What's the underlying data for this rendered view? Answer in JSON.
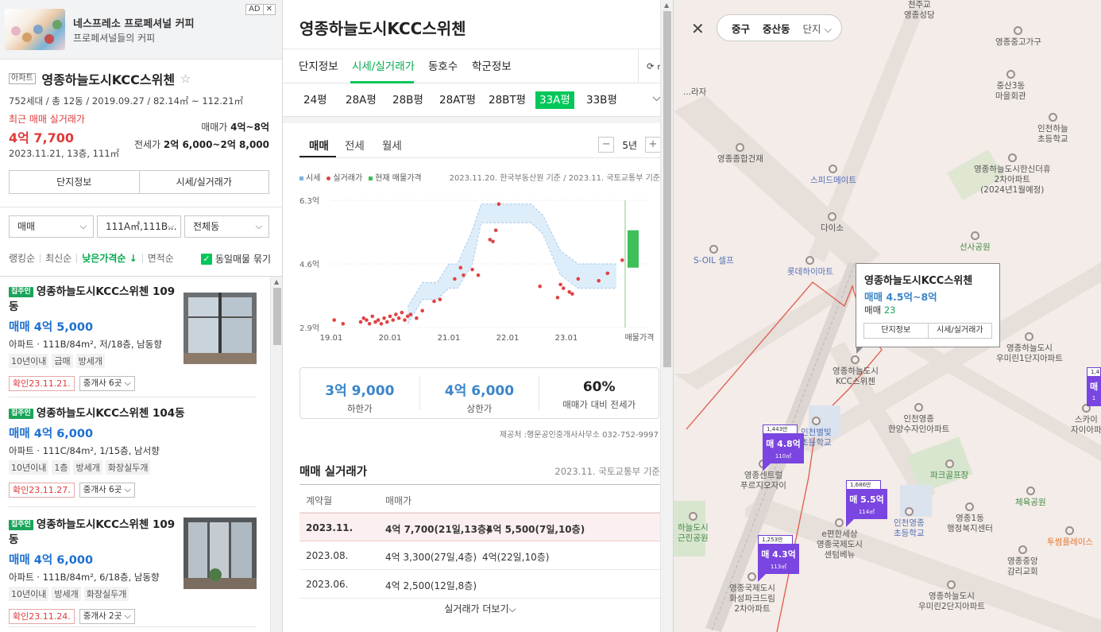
{
  "ad": {
    "title": "네스프레소 프로페셔널 커피",
    "subtitle": "프로페셔널들의 커피",
    "badge": "AD",
    "close": "✕"
  },
  "complex": {
    "type_tag": "아파트",
    "name": "영종하늘도시KCC스위첸",
    "star": "☆",
    "spec": "752세대 / 총 12동 / 2019.09.27 / 82.14㎡ ~ 112.21㎡",
    "recent_label": "최근 매매 실거래가",
    "recent_price": "4억 7,700",
    "recent_date": "2023.11.21, 13층, 111㎡",
    "sale_range_label": "매매가 ",
    "sale_range": "4억~8억",
    "jeonse_range_label": "전세가 ",
    "jeonse_range": "2억 6,000~2억 8,000",
    "btn_info": "단지정보",
    "btn_price": "시세/실거래가"
  },
  "filters": {
    "trade": "매매",
    "area": "111A㎡,111B...",
    "dong": "전체동",
    "sorts": [
      "랭킹순",
      "최신순",
      "낮은가격순 ↓",
      "면적순"
    ],
    "active_sort": 2,
    "group_label": "동일매물 묶기"
  },
  "listings": [
    {
      "badge": "집주인",
      "title": "영종하늘도시KCC스위첸 109동",
      "price": "매매 4억 5,000",
      "spec": "아파트 · 111B/84m², 저/18층, 남동향",
      "tags": [
        "10년이내",
        "급매",
        "방세개"
      ],
      "confirm": "확인23.11.21.",
      "agents": "중개사 6곳 ⌵",
      "has_photo": true
    },
    {
      "badge": "집주인",
      "title": "영종하늘도시KCC스위첸 104동",
      "price": "매매 4억 6,000",
      "spec": "아파트 · 111C/84m², 1/15층, 남서향",
      "tags": [
        "10년이내",
        "1층",
        "방세개",
        "화장실두개"
      ],
      "confirm": "확인23.11.27.",
      "agents": "중개사 6곳 ⌵",
      "has_photo": false
    },
    {
      "badge": "집주인",
      "title": "영종하늘도시KCC스위첸 109동",
      "price": "매매 4억 6,000",
      "spec": "아파트 · 111B/84m², 6/18층, 남동향",
      "tags": [
        "10년이내",
        "방세개",
        "화장실두개"
      ],
      "confirm": "확인23.11.24.",
      "agents": "중개사 2곳 ⌵",
      "has_photo": true
    }
  ],
  "center": {
    "title": "영종하늘도시KCC스위첸",
    "tabs": [
      "단지정보",
      "시세/실거래가",
      "동호수",
      "학군정보"
    ],
    "active_tab": 1,
    "refresh_label": "⟳ ㎡",
    "sizes": [
      "24평",
      "28A평",
      "28B평",
      "28AT평",
      "28BT평",
      "33A평",
      "33B평"
    ],
    "active_size": 5,
    "sub_tabs": [
      "매매",
      "전세",
      "월세"
    ],
    "period": "5년",
    "period_minus": "−",
    "period_plus": "+",
    "legend": [
      "시세",
      "실거래가",
      "현재 매물가격"
    ],
    "legend_src": "2023.11.20. 한국부동산원 기준 / 2023.11. 국토교통부 기준",
    "stats": [
      {
        "value": "3억 9,000",
        "label": "하한가"
      },
      {
        "value": "4억 6,000",
        "label": "상한가"
      },
      {
        "value": "60%",
        "label": "매매가 대비 전세가"
      }
    ],
    "provider": "제공처 :행운공인중개사사무소 032-752-9997",
    "deal_head": "매매 실거래가",
    "deal_src": "2023.11. 국토교통부 기준",
    "deal_cols": [
      "계약월",
      "매매가"
    ],
    "deals": [
      {
        "month": "2023.11.",
        "a": "4억 7,700(21일,13층)",
        "b": "4억 5,500(7일,10층)"
      },
      {
        "month": "2023.08.",
        "a": "4억 3,300(27일,4층)",
        "b": "4억(22일,10층)"
      },
      {
        "month": "2023.06.",
        "a": "4억 2,500(12일,8층)",
        "b": ""
      }
    ],
    "more": "실거래가 더보기⌵"
  },
  "chart_data": {
    "type": "line",
    "y_tick_labels": [
      "6.3억",
      "4.6억",
      "2.9억"
    ],
    "y_ticks": [
      6.3,
      4.6,
      2.9
    ],
    "x_tick_labels": [
      "19.01",
      "20.01",
      "21.01",
      "22.01",
      "23.01",
      "매물가격"
    ],
    "ylim": [
      2.9,
      6.3
    ],
    "grid": true,
    "series": [
      {
        "name": "시세",
        "x": [
          2019.0,
          2019.9,
          2020.3,
          2020.55,
          2020.8,
          2021.0,
          2021.15,
          2021.4,
          2021.55,
          2021.7,
          2022.0,
          2022.4,
          2022.6,
          2022.9,
          2023.2,
          2023.4,
          2023.85
        ],
        "upper": [
          null,
          null,
          3.45,
          4.1,
          4.1,
          4.6,
          4.6,
          5.5,
          6.2,
          6.2,
          6.2,
          6.2,
          5.9,
          4.95,
          4.6,
          4.6,
          4.6
        ],
        "lower": [
          null,
          null,
          3.0,
          3.65,
          3.65,
          3.95,
          3.95,
          4.6,
          5.7,
          5.7,
          5.7,
          5.7,
          5.4,
          4.3,
          3.95,
          3.95,
          3.95
        ]
      },
      {
        "name": "실거래가",
        "points": [
          [
            2019.05,
            3.1
          ],
          [
            2019.2,
            3.0
          ],
          [
            2019.5,
            3.05
          ],
          [
            2019.55,
            3.15
          ],
          [
            2019.6,
            3.1
          ],
          [
            2019.65,
            3.0
          ],
          [
            2019.7,
            3.2
          ],
          [
            2019.75,
            3.05
          ],
          [
            2019.8,
            3.1
          ],
          [
            2019.85,
            3.0
          ],
          [
            2019.9,
            3.15
          ],
          [
            2019.95,
            3.05
          ],
          [
            2020.0,
            3.2
          ],
          [
            2020.05,
            3.1
          ],
          [
            2020.1,
            3.25
          ],
          [
            2020.15,
            3.15
          ],
          [
            2020.2,
            3.3
          ],
          [
            2020.25,
            3.1
          ],
          [
            2020.3,
            3.2
          ],
          [
            2020.35,
            3.25
          ],
          [
            2020.45,
            3.15
          ],
          [
            2020.55,
            3.35
          ],
          [
            2020.75,
            3.6
          ],
          [
            2020.85,
            3.65
          ],
          [
            2021.1,
            4.2
          ],
          [
            2021.2,
            4.5
          ],
          [
            2021.25,
            4.3
          ],
          [
            2021.4,
            4.45
          ],
          [
            2021.5,
            4.3
          ],
          [
            2021.7,
            5.25
          ],
          [
            2021.75,
            5.2
          ],
          [
            2021.8,
            5.5
          ],
          [
            2021.85,
            6.2
          ],
          [
            2022.55,
            4.0
          ],
          [
            2022.85,
            3.7
          ],
          [
            2022.9,
            4.05
          ],
          [
            2022.95,
            3.95
          ],
          [
            2023.05,
            3.85
          ],
          [
            2023.1,
            3.8
          ],
          [
            2023.2,
            4.2
          ],
          [
            2023.55,
            4.15
          ],
          [
            2023.7,
            4.35
          ],
          [
            2023.95,
            4.7
          ]
        ]
      },
      {
        "name": "현재 매물가격",
        "low": 4.5,
        "high": 5.5
      }
    ],
    "colors": {
      "band": "#a8c8e8",
      "band_fill": "#ddeefa",
      "deal": "#e04343",
      "listing": "#3fbf5a",
      "current_line": "#7bd17b"
    }
  },
  "map": {
    "close": "✕",
    "breadcrumb": [
      "중구",
      "중산동",
      "단지 ⌵"
    ],
    "popup": {
      "title": "영종하늘도시KCC스위첸",
      "price": "매매 4.5억~8억",
      "count_label": "매매 ",
      "count": "23",
      "btn_info": "단지정보",
      "btn_price": "시세/실거래가"
    },
    "pois": [
      {
        "name": "천주교\n영종성당",
        "kind": "plain"
      },
      {
        "name": "영종중고가구",
        "kind": "plain"
      },
      {
        "name": "중산3동\n마을회관",
        "kind": "plain"
      },
      {
        "name": "인천하늘\n초등학교",
        "kind": "plain"
      },
      {
        "name": "영종종합건재",
        "kind": "plain"
      },
      {
        "name": "스피드메이트",
        "kind": "blue"
      },
      {
        "name": "영종하늘도시한신더휴\n2차아파트\n(2024년1월예정)",
        "kind": "plain"
      },
      {
        "name": "다이소",
        "kind": "plain"
      },
      {
        "name": "선사공원",
        "kind": "green"
      },
      {
        "name": "S-OIL 셀프",
        "kind": "blue"
      },
      {
        "name": "롯데하이마트",
        "kind": "blue"
      },
      {
        "name": "영종하늘도시\n우미린1단지아파트",
        "kind": "plain"
      },
      {
        "name": "영종하늘도시\nKCC스위첸",
        "kind": "plain"
      },
      {
        "name": "인천영종\n한양수자인아파트",
        "kind": "plain"
      },
      {
        "name": "인천별빛\n초등학교",
        "kind": "blue"
      },
      {
        "name": "영종센트럴\n푸르지오자이",
        "kind": "plain"
      },
      {
        "name": "파크골프장",
        "kind": "green"
      },
      {
        "name": "체육공원",
        "kind": "green"
      },
      {
        "name": "인천영종\n초등학교",
        "kind": "blue"
      },
      {
        "name": "영종1동\n행정복지센터",
        "kind": "plain"
      },
      {
        "name": "e편한세상\n영종국제도시\n센텀베뉴",
        "kind": "plain"
      },
      {
        "name": "투썸플레이스",
        "kind": "orange"
      },
      {
        "name": "영종중앙\n감리교회",
        "kind": "plain"
      },
      {
        "name": "하늘도시\n근린공원",
        "kind": "green"
      },
      {
        "name": "영종국제도시\n화성파크드림\n2차아파트",
        "kind": "plain"
      },
      {
        "name": "영종하늘도시\n우미린2단지아파트",
        "kind": "plain"
      },
      {
        "name": "스카이\n자이아파",
        "kind": "plain"
      },
      {
        "name": "...라자",
        "kind": "plain"
      }
    ],
    "pins": [
      {
        "top": "1,443만",
        "label": "매 4.8억",
        "area": "110㎡"
      },
      {
        "top": "1,686만",
        "label": "매 5.5억",
        "area": "114㎡"
      },
      {
        "top": "1,253만",
        "label": "매 4.3억",
        "area": "113㎡"
      },
      {
        "top": "1,4",
        "label": "매",
        "area": "1"
      }
    ]
  }
}
